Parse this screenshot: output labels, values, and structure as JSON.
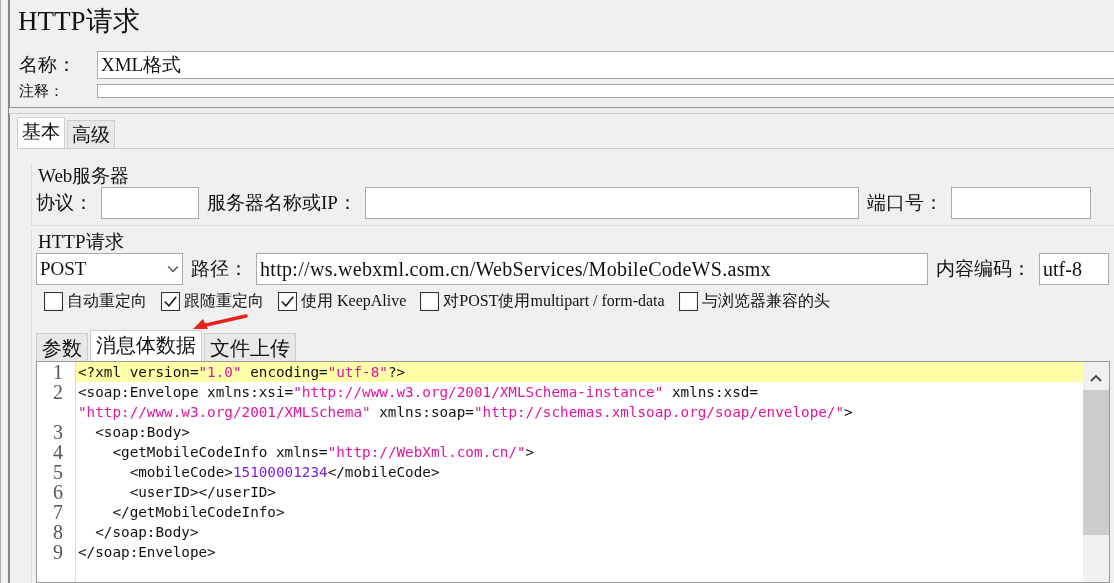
{
  "title": "HTTP请求",
  "name_field": {
    "label": "名称：",
    "value": "XML格式"
  },
  "comment_field": {
    "label": "注释："
  },
  "tabs": [
    {
      "label": "基本",
      "selected": true
    },
    {
      "label": "高级",
      "selected": false
    }
  ],
  "web_server": {
    "title": "Web服务器",
    "protocol_label": "协议：",
    "server_label": "服务器名称或IP：",
    "port_label": "端口号："
  },
  "http_request": {
    "title": "HTTP请求",
    "method": "POST",
    "path_label": "路径：",
    "path": "http://ws.webxml.com.cn/WebServices/MobileCodeWS.asmx",
    "encoding_label": "内容编码：",
    "encoding": "utf-8",
    "options": [
      {
        "label": "自动重定向",
        "checked": false
      },
      {
        "label": "跟随重定向",
        "checked": true
      },
      {
        "label": "使用 KeepAlive",
        "checked": true
      },
      {
        "label": "对POST使用multipart / form-data",
        "checked": false
      },
      {
        "label": "与浏览器兼容的头",
        "checked": false
      }
    ]
  },
  "body_tabs": [
    {
      "label": "参数",
      "selected": false
    },
    {
      "label": "消息体数据",
      "selected": true
    },
    {
      "label": "文件上传",
      "selected": false
    }
  ],
  "code": {
    "lines": [
      {
        "number": "1",
        "highlighted": true,
        "rows": [
          [
            {
              "kind": "plain",
              "text": "<?xml version="
            },
            {
              "kind": "string",
              "text": "\"1.0\""
            },
            {
              "kind": "plain",
              "text": " encoding="
            },
            {
              "kind": "string",
              "text": "\"utf-8\""
            },
            {
              "kind": "plain",
              "text": "?>"
            }
          ]
        ]
      },
      {
        "number": "2",
        "highlighted": false,
        "rows": [
          [
            {
              "kind": "plain",
              "text": "<soap:Envelope xmlns:xsi="
            },
            {
              "kind": "string",
              "text": "\"http://www.w3.org/2001/XMLSchema-instance\""
            },
            {
              "kind": "plain",
              "text": " xmlns:xsd="
            }
          ],
          [
            {
              "kind": "string",
              "text": "\"http://www.w3.org/2001/XMLSchema\""
            },
            {
              "kind": "plain",
              "text": " xmlns:soap="
            },
            {
              "kind": "string",
              "text": "\"http://schemas.xmlsoap.org/soap/envelope/\""
            },
            {
              "kind": "plain",
              "text": ">"
            }
          ]
        ]
      },
      {
        "number": "3",
        "highlighted": false,
        "rows": [
          [
            {
              "kind": "plain",
              "text": "  <soap:Body>"
            }
          ]
        ]
      },
      {
        "number": "4",
        "highlighted": false,
        "rows": [
          [
            {
              "kind": "plain",
              "text": "    <getMobileCodeInfo xmlns="
            },
            {
              "kind": "string",
              "text": "\"http://WebXml.com.cn/\""
            },
            {
              "kind": "plain",
              "text": ">"
            }
          ]
        ]
      },
      {
        "number": "5",
        "highlighted": false,
        "rows": [
          [
            {
              "kind": "plain",
              "text": "      <mobileCode>"
            },
            {
              "kind": "value",
              "text": "15100001234"
            },
            {
              "kind": "plain",
              "text": "</mobileCode>"
            }
          ]
        ]
      },
      {
        "number": "6",
        "highlighted": false,
        "rows": [
          [
            {
              "kind": "plain",
              "text": "      <userID></userID>"
            }
          ]
        ]
      },
      {
        "number": "7",
        "highlighted": false,
        "rows": [
          [
            {
              "kind": "plain",
              "text": "    </getMobileCodeInfo>"
            }
          ]
        ]
      },
      {
        "number": "8",
        "highlighted": false,
        "rows": [
          [
            {
              "kind": "plain",
              "text": "  </soap:Body>"
            }
          ]
        ]
      },
      {
        "number": "9",
        "highlighted": false,
        "rows": [
          [
            {
              "kind": "plain",
              "text": "</soap:Envelope>"
            }
          ]
        ]
      }
    ]
  }
}
